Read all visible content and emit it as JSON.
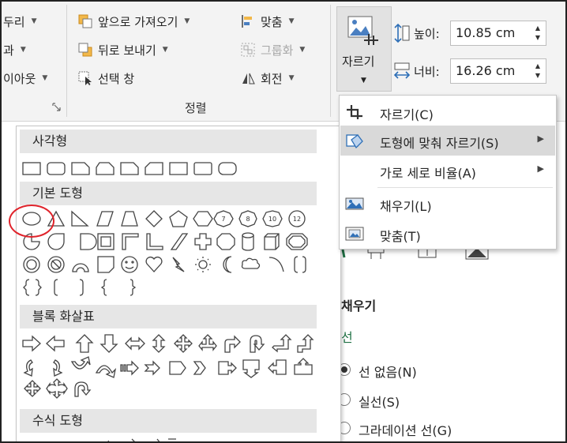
{
  "ribbon": {
    "left_group": {
      "item1": "두리",
      "item2": "과",
      "item3": "이아웃"
    },
    "arrange_group": {
      "bring_forward": "앞으로 가져오기",
      "send_backward": "뒤로 보내기",
      "selection_pane": "선택 창",
      "align": "맞춤",
      "group": "그룹화",
      "rotate": "회전",
      "label": "정렬"
    },
    "crop": {
      "label": "자르기"
    },
    "size": {
      "height_label": "높이:",
      "height_value": "10.85 cm",
      "width_label": "너비:",
      "width_value": "16.26 cm"
    }
  },
  "gallery": {
    "categories": [
      {
        "label": "사각형"
      },
      {
        "label": "기본 도형"
      },
      {
        "label": "블록 화살표"
      },
      {
        "label": "수식 도형"
      }
    ],
    "basic_numbers": [
      "7",
      "8",
      "10",
      "12"
    ]
  },
  "crop_menu": {
    "items": [
      {
        "label": "자르기(C)",
        "has_submenu": false
      },
      {
        "label": "도형에 맞춰 자르기(S)",
        "has_submenu": true
      },
      {
        "label": "가로 세로 비율(A)",
        "has_submenu": true
      },
      {
        "label": "채우기(L)",
        "has_submenu": false
      },
      {
        "label": "맞춤(T)",
        "has_submenu": false
      }
    ]
  },
  "side_pane": {
    "fill_heading": "채우기",
    "line_heading": "선",
    "options": [
      {
        "label": "선 없음(N)",
        "selected": true
      },
      {
        "label": "실선(S)",
        "selected": false
      },
      {
        "label": "그라데이션 선(G)",
        "selected": false
      }
    ]
  },
  "colors": {
    "ribbon_bg": "#f3f3f3",
    "menu_highlight": "#d9d9d9",
    "highlight_circle": "#e0232b",
    "pane_link": "#217346"
  }
}
